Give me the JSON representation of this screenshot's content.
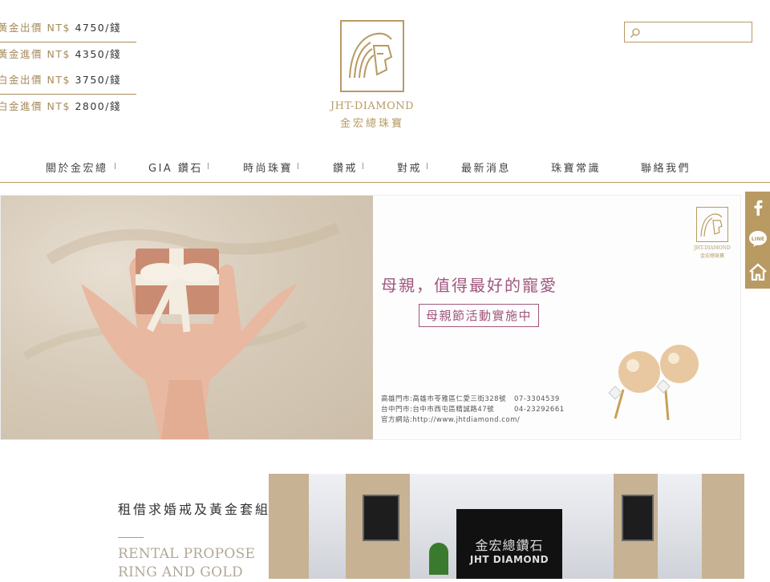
{
  "prices": [
    {
      "label": "黃金出價",
      "currency": "NT$",
      "value": "4750/錢"
    },
    {
      "label": "黃金進價",
      "currency": "NT$",
      "value": "4350/錢"
    },
    {
      "label": "白金出價",
      "currency": "NT$",
      "value": "3750/錢"
    },
    {
      "label": "白金進價",
      "currency": "NT$",
      "value": "2800/錢"
    }
  ],
  "logo": {
    "name": "JHT-DIAMOND",
    "cn": "金宏總珠寶"
  },
  "search": {
    "placeholder": "",
    "icon": "search-icon"
  },
  "nav": [
    "關於金宏總",
    "GIA 鑽石",
    "時尚珠寶",
    "鑽戒",
    "對戒",
    "最新消息",
    "珠寶常識",
    "聯絡我們"
  ],
  "banner": {
    "title": "母親，值得最好的寵愛",
    "badge": "母親節活動實施中",
    "logo_name": "JHT-DIAMOND",
    "logo_cn": "金宏總珠寶",
    "contact": [
      {
        "text": "高雄門市:高雄市苓雅區仁愛三街328號",
        "phone": "07-3304539"
      },
      {
        "text": "台中門市:台中市西屯區精誠路47號",
        "phone": "04-23292661"
      },
      {
        "text": "官方網站:http://www.jhtdiamond.com/",
        "phone": ""
      }
    ]
  },
  "social": [
    "facebook-icon",
    "line-icon",
    "home-icon"
  ],
  "social_labels": {
    "line": "LINE"
  },
  "rental": {
    "cn": "租借求婚戒及黃金套組",
    "en": "RENTAL PROPOSE RING AND GOLD"
  },
  "store": {
    "sign_cn": "金宏總鑽石",
    "sign_en": "JHT DIAMOND"
  },
  "colors": {
    "gold": "#b89a62",
    "rose": "#a0567d"
  }
}
